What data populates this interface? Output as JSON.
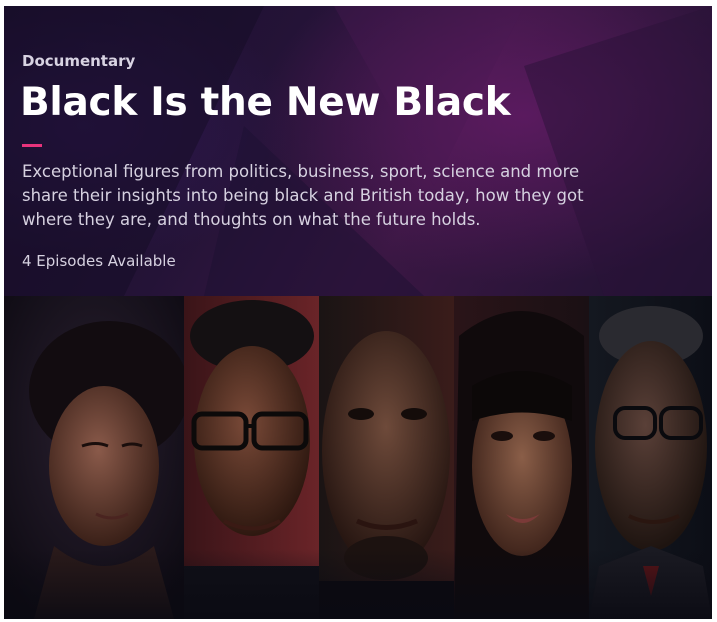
{
  "programme": {
    "genre": "Documentary",
    "title": "Black Is the New Black",
    "description": "Exceptional figures from politics, business, sport, science and more share their insights into being black and British today, how they got where they are, and thoughts on what the future holds.",
    "availability": "4 Episodes Available"
  },
  "colors": {
    "accent": "#e8337c",
    "title_text": "#ffffff",
    "body_text": "#d6d1e0",
    "hero_purple": "#3a1743"
  },
  "portraits": {
    "count": 5
  }
}
